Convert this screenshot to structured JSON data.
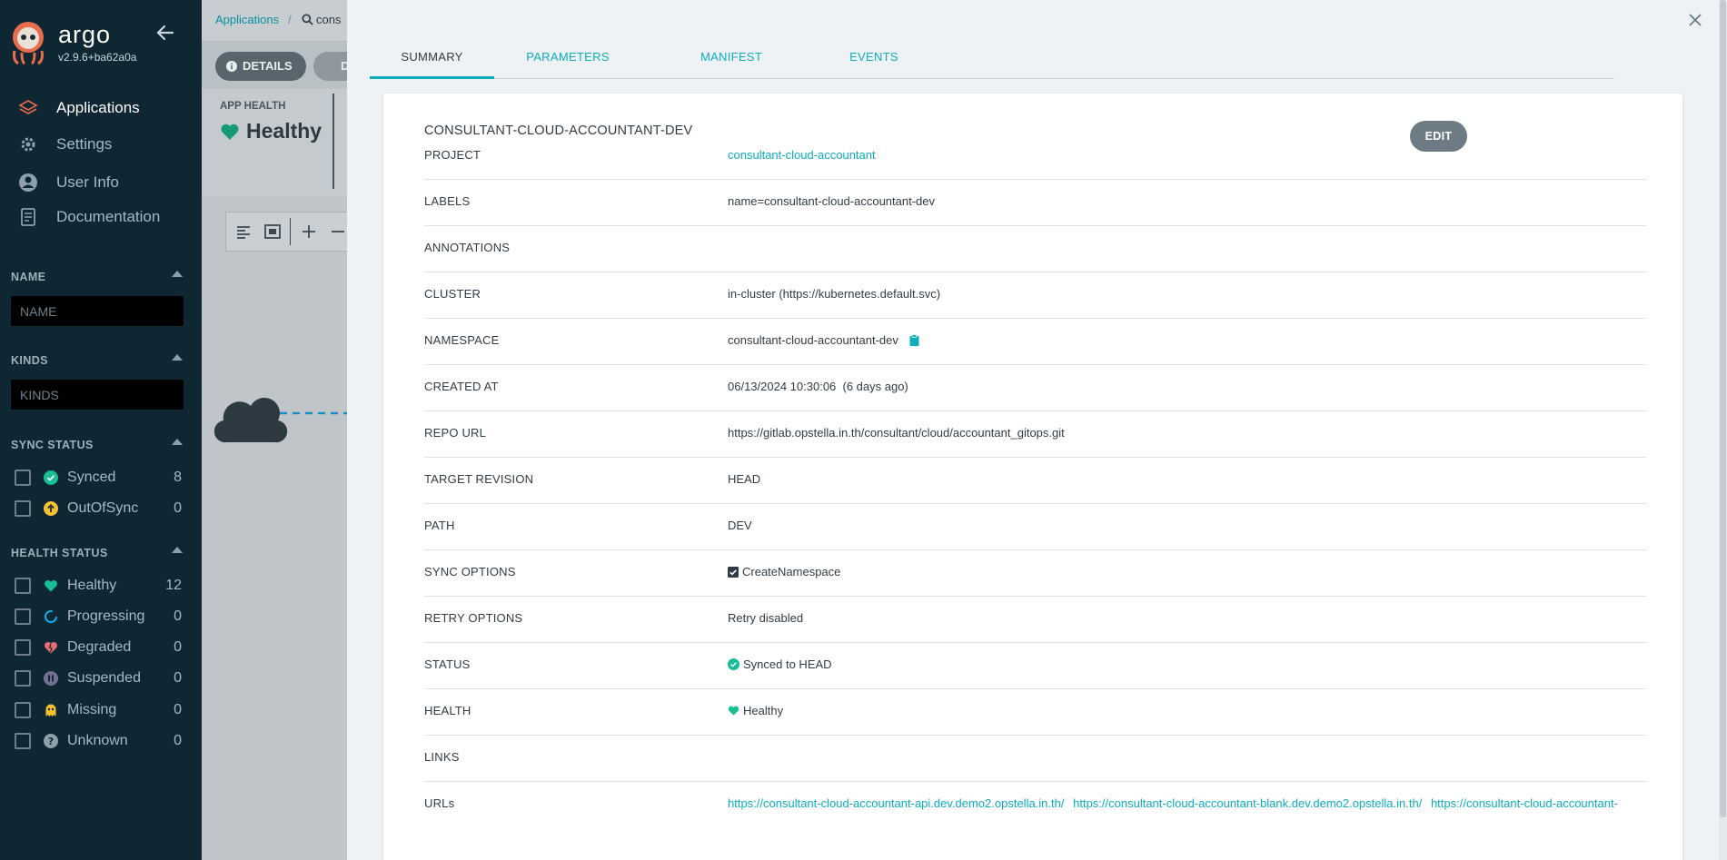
{
  "sidebar": {
    "app_name": "argo",
    "version": "v2.9.6+ba62a0a",
    "nav": [
      {
        "label": "Applications",
        "icon": "layers-icon",
        "active": true
      },
      {
        "label": "Settings",
        "icon": "gear-icon",
        "active": false
      },
      {
        "label": "User Info",
        "icon": "user-icon",
        "active": false
      },
      {
        "label": "Documentation",
        "icon": "book-icon",
        "active": false
      }
    ],
    "filters": {
      "name": {
        "title": "NAME",
        "placeholder": "NAME"
      },
      "kinds": {
        "title": "KINDS",
        "placeholder": "KINDS"
      },
      "sync_status": {
        "title": "SYNC STATUS",
        "items": [
          {
            "label": "Synced",
            "count": "8",
            "icon": "synced-icon"
          },
          {
            "label": "OutOfSync",
            "count": "0",
            "icon": "out-of-sync-icon"
          }
        ]
      },
      "health_status": {
        "title": "HEALTH STATUS",
        "items": [
          {
            "label": "Healthy",
            "count": "12",
            "icon": "heart-icon"
          },
          {
            "label": "Progressing",
            "count": "0",
            "icon": "progressing-icon"
          },
          {
            "label": "Degraded",
            "count": "0",
            "icon": "broken-heart-icon"
          },
          {
            "label": "Suspended",
            "count": "0",
            "icon": "pause-icon"
          },
          {
            "label": "Missing",
            "count": "0",
            "icon": "ghost-icon"
          },
          {
            "label": "Unknown",
            "count": "0",
            "icon": "question-icon"
          }
        ]
      }
    }
  },
  "background": {
    "breadcrumb": [
      "Applications",
      "cons"
    ],
    "details_button": "DETAILS",
    "diff_button": "D",
    "app_health_label": "APP HEALTH",
    "app_health_value": "Healthy"
  },
  "panel": {
    "tabs": [
      {
        "label": "SUMMARY",
        "active": true
      },
      {
        "label": "PARAMETERS",
        "active": false
      },
      {
        "label": "MANIFEST",
        "active": false
      },
      {
        "label": "EVENTS",
        "active": false
      }
    ],
    "title": "CONSULTANT-CLOUD-ACCOUNTANT-DEV",
    "edit_label": "EDIT",
    "rows": {
      "project": {
        "label": "PROJECT",
        "value": "consultant-cloud-accountant"
      },
      "labels": {
        "label": "LABELS",
        "value": "name=consultant-cloud-accountant-dev"
      },
      "annotations": {
        "label": "ANNOTATIONS",
        "value": ""
      },
      "cluster": {
        "label": "CLUSTER",
        "value": "in-cluster (https://kubernetes.default.svc)"
      },
      "namespace": {
        "label": "NAMESPACE",
        "value": "consultant-cloud-accountant-dev"
      },
      "created_at": {
        "label": "CREATED AT",
        "value": "06/13/2024 10:30:06  (6 days ago)"
      },
      "repo_url": {
        "label": "REPO URL",
        "value": "https://gitlab.opstella.in.th/consultant/cloud/accountant_gitops.git"
      },
      "target_revision": {
        "label": "TARGET REVISION",
        "value": "HEAD"
      },
      "path": {
        "label": "PATH",
        "value": "DEV"
      },
      "sync_options": {
        "label": "SYNC OPTIONS",
        "value": "CreateNamespace"
      },
      "retry_options": {
        "label": "RETRY OPTIONS",
        "value": "Retry disabled"
      },
      "status": {
        "label": "STATUS",
        "value": "Synced to HEAD"
      },
      "health": {
        "label": "HEALTH",
        "value": "Healthy"
      },
      "links": {
        "label": "LINKS",
        "value": ""
      },
      "urls": {
        "label": "URLs",
        "values": [
          "https://consultant-cloud-accountant-api.dev.demo2.opstella.in.th/",
          "https://consultant-cloud-accountant-blank.dev.demo2.opstella.in.th/",
          "https://consultant-cloud-accountant-"
        ]
      }
    }
  },
  "colors": {
    "sidebar_bg": "#0f2733",
    "accent": "#0dadbe",
    "healthy": "#18be94",
    "degraded": "#e96d76",
    "suspended": "#766f94",
    "missing": "#f4c030",
    "progressing": "#0dadea"
  }
}
